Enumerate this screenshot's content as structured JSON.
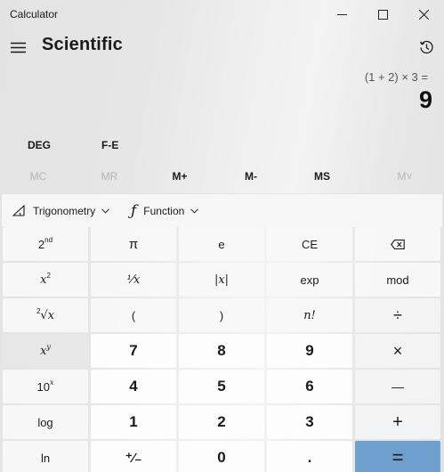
{
  "window": {
    "title": "Calculator"
  },
  "header": {
    "mode_title": "Scientific"
  },
  "display": {
    "expression": "(1 + 2) × 3 =",
    "result": "9"
  },
  "modes": {
    "angle": "DEG",
    "notation": "F-E"
  },
  "memory": {
    "mc": "MC",
    "mr": "MR",
    "m_plus": "M+",
    "m_minus": "M-",
    "ms": "MS",
    "m_list": "M˅"
  },
  "toolbar": {
    "trigonometry": "Trigonometry",
    "function": "Function"
  },
  "keys": {
    "second": "2",
    "second_sup": "nd",
    "pi": "π",
    "e": "e",
    "ce": "CE",
    "x_squared": "x",
    "x_squared_sup": "2",
    "reciprocal": "¹⁄x",
    "abs": "|x|",
    "exp": "exp",
    "mod": "mod",
    "sqrt": "√x",
    "sqrt_sup": "2",
    "open_paren": "(",
    "close_paren": ")",
    "factorial": "n!",
    "divide": "÷",
    "x_pow_y": "x",
    "x_pow_y_sup": "y",
    "seven": "7",
    "eight": "8",
    "nine": "9",
    "multiply": "×",
    "ten_pow": "10",
    "ten_pow_sup": "x",
    "four": "4",
    "five": "5",
    "six": "6",
    "minus": "—",
    "log": "log",
    "one": "1",
    "two": "2",
    "three": "3",
    "plus": "+",
    "ln": "ln",
    "negate": "⁺⁄₋",
    "zero": "0",
    "decimal": ".",
    "equals": "="
  }
}
